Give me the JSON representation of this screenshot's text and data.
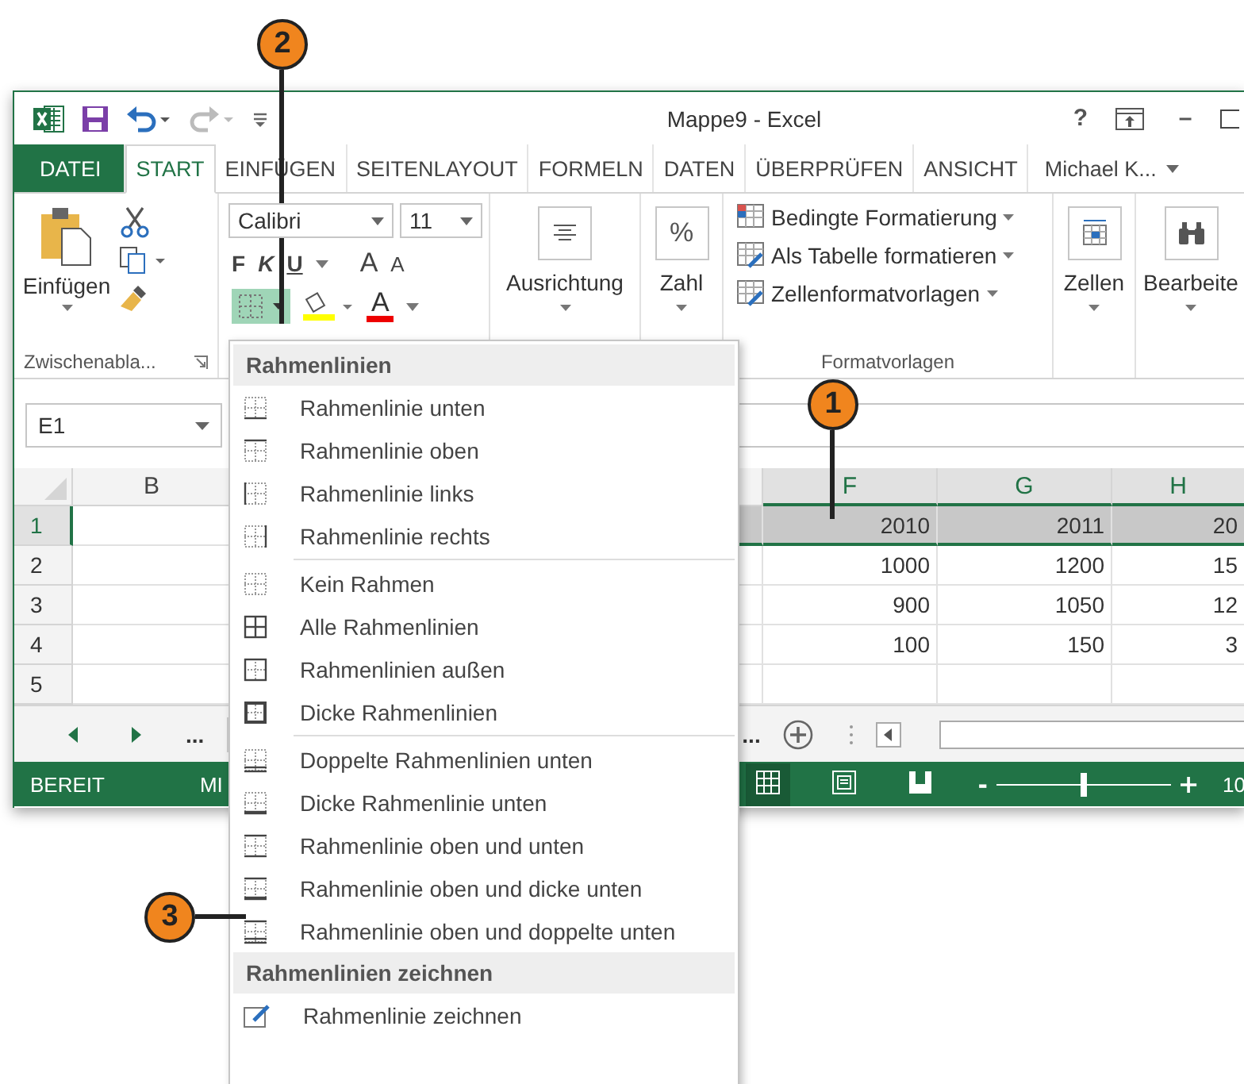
{
  "title_bar": {
    "title": "Mappe9 - Excel",
    "help": "?",
    "minimize": "–",
    "redo": {
      "disabled": true
    }
  },
  "tabs": [
    {
      "label": "DATEI",
      "kind": "file",
      "selected": false
    },
    {
      "label": "START",
      "kind": "tab",
      "selected": true
    },
    {
      "label": "EINFÜGEN",
      "kind": "tab",
      "selected": false
    },
    {
      "label": "SEITENLAYOUT",
      "kind": "tab",
      "selected": false
    },
    {
      "label": "FORMELN",
      "kind": "tab",
      "selected": false
    },
    {
      "label": "DATEN",
      "kind": "tab",
      "selected": false
    },
    {
      "label": "ÜBERPRÜFEN",
      "kind": "tab",
      "selected": false
    },
    {
      "label": "ANSICHT",
      "kind": "tab",
      "selected": false
    }
  ],
  "user": "Michael K...",
  "ribbon": {
    "clipboard": {
      "paste": "Einfügen",
      "label": "Zwischenabla..."
    },
    "font": {
      "name": "Calibri",
      "size": "11",
      "bold": "F",
      "italic": "K",
      "underline": "U",
      "grow": "A",
      "shrink": "A",
      "font_color": "A",
      "borders_selected": true
    },
    "alignment": "Ausrichtung",
    "number": {
      "symbol": "%",
      "label": "Zahl"
    },
    "styles": {
      "items": [
        "Bedingte Formatierung",
        "Als Tabelle formatieren",
        "Zellenformatvorlagen"
      ],
      "label": "Formatvorlagen"
    },
    "cells": "Zellen",
    "editing": "Bearbeite"
  },
  "name_box": "E1",
  "sheet": {
    "columns": [
      {
        "label": "B",
        "selected": false
      },
      {
        "label": "F",
        "selected": true
      },
      {
        "label": "G",
        "selected": true
      },
      {
        "label": "H",
        "selected": true
      }
    ],
    "rows": [
      {
        "label": "1",
        "selected": true,
        "values": [
          "2010",
          "2011",
          "20"
        ]
      },
      {
        "label": "2",
        "selected": false,
        "values": [
          "1000",
          "1200",
          "15"
        ]
      },
      {
        "label": "3",
        "selected": false,
        "values": [
          "900",
          "1050",
          "12"
        ]
      },
      {
        "label": "4",
        "selected": false,
        "values": [
          "100",
          "150",
          "3"
        ]
      },
      {
        "label": "5",
        "selected": false,
        "values": []
      }
    ]
  },
  "sheet_bar": {
    "more_left": "...",
    "more_right": "..."
  },
  "status_bar": {
    "ready": "BEREIT",
    "stat": "MI",
    "views": [
      {
        "kind": "normal",
        "selected": true
      },
      {
        "kind": "page_layout",
        "selected": false
      },
      {
        "kind": "page_break",
        "selected": false
      }
    ],
    "zoom_out": "-",
    "zoom": {
      "level": 0.5
    },
    "zoom_value": "10"
  },
  "menu": {
    "items": [
      {
        "kind": "header",
        "label": "Rahmenlinien"
      },
      {
        "kind": "bottom",
        "label": "Rahmenlinie unten"
      },
      {
        "kind": "top",
        "label": "Rahmenlinie oben"
      },
      {
        "kind": "left",
        "label": "Rahmenlinie links"
      },
      {
        "kind": "right",
        "label": "Rahmenlinie rechts"
      },
      {
        "kind": "separator"
      },
      {
        "kind": "none",
        "label": "Kein Rahmen"
      },
      {
        "kind": "all",
        "label": "Alle Rahmenlinien"
      },
      {
        "kind": "outside",
        "label": "Rahmenlinien außen"
      },
      {
        "kind": "thick_box",
        "label": "Dicke Rahmenlinien"
      },
      {
        "kind": "separator"
      },
      {
        "kind": "double_bottom",
        "label": "Doppelte Rahmenlinien unten"
      },
      {
        "kind": "thick_bottom",
        "label": "Dicke Rahmenlinie unten"
      },
      {
        "kind": "top_bottom",
        "label": "Rahmenlinie oben und unten"
      },
      {
        "kind": "top_thick_bottom",
        "label": "Rahmenlinie oben und dicke unten"
      },
      {
        "kind": "top_double_bottom",
        "label": "Rahmenlinie oben und doppelte unten"
      },
      {
        "kind": "header",
        "label": "Rahmenlinien zeichnen"
      },
      {
        "kind": "draw",
        "label": "Rahmenlinie zeichnen"
      }
    ]
  },
  "callouts": [
    {
      "number": "2"
    },
    {
      "number": "1"
    },
    {
      "number": "3"
    }
  ]
}
